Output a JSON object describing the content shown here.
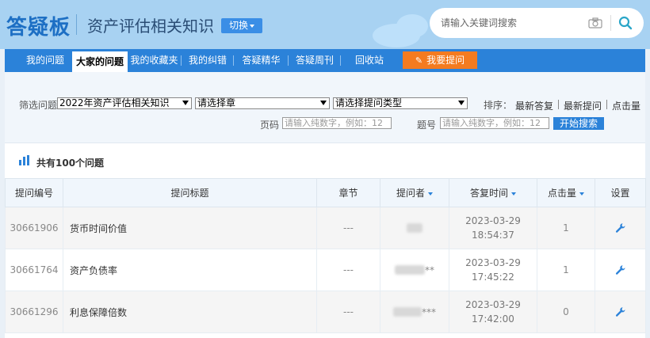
{
  "header": {
    "logo": "答疑板",
    "subject": "资产评估相关知识",
    "switch_label": "切换",
    "search_placeholder": "请输入关键词搜索",
    "icons": [
      "camera-icon",
      "search-icon"
    ]
  },
  "nav": {
    "items": [
      "我的问题",
      "大家的问题",
      "我的收藏夹",
      "我的纠错",
      "答疑精华",
      "答疑周刊",
      "回收站"
    ],
    "active": "大家的问题",
    "ask_label": "我要提问"
  },
  "filter": {
    "label": "筛选问题",
    "year_select": "2022年资产评估相关知识",
    "chapter_select": "请选择章",
    "type_select": "请选择提问类型",
    "sort_label": "排序：",
    "sort_options": [
      "最新答复",
      "最新提问",
      "点击量"
    ],
    "page_label": "页码",
    "page_placeholder": "请输入纯数字，例如：12",
    "question_label": "题号",
    "question_placeholder": "请输入纯数字，例如：12",
    "start_button": "开始搜索"
  },
  "count_text": "共有100个问题",
  "table": {
    "headers": [
      "提问编号",
      "提问标题",
      "章节",
      "提问者",
      "答复时间",
      "点击量",
      "设置"
    ],
    "rows": [
      {
        "id": "30661906",
        "title": "货币时间价值",
        "chapter": "---",
        "asker_suffix": "",
        "date": "2023-03-29",
        "time": "18:54:37",
        "clicks": "1"
      },
      {
        "id": "30661764",
        "title": "资产负债率",
        "chapter": "---",
        "asker_suffix": "**",
        "date": "2023-03-29",
        "time": "17:45:22",
        "clicks": "1"
      },
      {
        "id": "30661296",
        "title": "利息保障倍数",
        "chapter": "---",
        "asker_suffix": "***",
        "date": "2023-03-29",
        "time": "17:42:00",
        "clicks": "0"
      }
    ]
  },
  "colors": {
    "header_bg": "#a8d2f2",
    "nav_bg": "#2b82d9",
    "ask_button": "#f47b20",
    "logo": "#1d6fc4"
  }
}
